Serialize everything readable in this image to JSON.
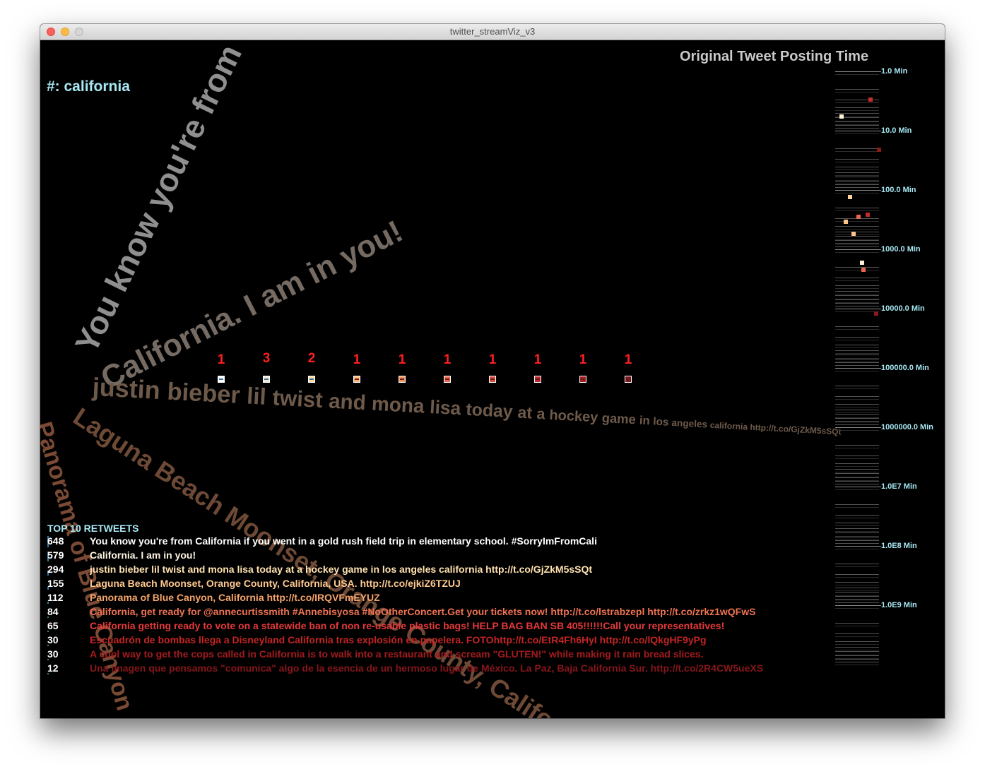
{
  "window": {
    "title": "twitter_streamViz_v3"
  },
  "hashtag": "#: california",
  "timeline": {
    "title": "Original Tweet Posting Time",
    "axis_labels": [
      "1.0 Min",
      "10.0 Min",
      "100.0 Min",
      "1000.0 Min",
      "10000.0 Min",
      "100000.0 Min",
      "1000000.0 Min",
      "1.0E7 Min",
      "1.0E8 Min",
      "1.0E9 Min"
    ],
    "points": [
      {
        "minutes": 5.8,
        "color": "#fff3d6"
      },
      {
        "minutes": 1700,
        "color": "#fff3d6"
      },
      {
        "minutes": 21,
        "color": "#8b1a1a"
      },
      {
        "minutes": 130,
        "color": "#ffd39b"
      },
      {
        "minutes": 280,
        "color": "#e8664f"
      },
      {
        "minutes": 340,
        "color": "#ffc38a"
      },
      {
        "minutes": 540,
        "color": "#ffc38a"
      },
      {
        "minutes": 2200,
        "color": "#e8664f"
      },
      {
        "minutes": 3,
        "color": "#c62a2a"
      },
      {
        "minutes": 260,
        "color": "#c62a2a"
      },
      {
        "minutes": 12000,
        "color": "#8b1a1a"
      }
    ]
  },
  "categories": [
    {
      "count": "1",
      "color": "#ffffff"
    },
    {
      "count": "3",
      "color": "#f4ecd0"
    },
    {
      "count": "2",
      "color": "#ffd9a0"
    },
    {
      "count": "1",
      "color": "#f9b877"
    },
    {
      "count": "1",
      "color": "#f4935c"
    },
    {
      "count": "1",
      "color": "#e8664f"
    },
    {
      "count": "1",
      "color": "#d84a3c"
    },
    {
      "count": "1",
      "color": "#c1262c"
    },
    {
      "count": "1",
      "color": "#a61d24"
    },
    {
      "count": "1",
      "color": "#7a1620"
    }
  ],
  "floating_tweets": [
    {
      "text": "You know you're from",
      "color": "#8f8f8f"
    },
    {
      "text": "California. I am in you!",
      "color": "#756b63"
    },
    {
      "text": "justin bieber lil twist and mona lisa today at a hockey game in los angeles california  http://t.co/GjZkM5sSQt",
      "color": "#6e5a4a"
    },
    {
      "text": "Laguna Beach Moonset, Orange County, California",
      "color": "#6e4a36"
    },
    {
      "text": "Panorama of Blue Canyon",
      "color": "#7a4a34"
    }
  ],
  "top_retweets": {
    "heading": "TOP 10 RETWEETS",
    "items": [
      {
        "count": "648",
        "text": "You know you're from California if you went in a gold rush field trip in elementary school. #SorryImFromCali",
        "color": "#ffffff"
      },
      {
        "count": "579",
        "text": "California. I am in you!",
        "color": "#fdf5e2"
      },
      {
        "count": "294",
        "text": "justin bieber lil twist and mona lisa today at a hockey game in los angeles california  http://t.co/GjZkM5sSQt",
        "color": "#ffe3b0"
      },
      {
        "count": "155",
        "text": "Laguna Beach Moonset, Orange County, California, USA. http://t.co/ejkiZ6TZUJ",
        "color": "#ffc98f"
      },
      {
        "count": "112",
        "text": "Panorama of Blue Canyon, California http://t.co/IRQVFmEYUZ",
        "color": "#f6a56a"
      },
      {
        "count": "84",
        "text": "California, get ready for @annecurtissmith #Annebisyosa #NoOtherConcert.Get your tickets now! http://t.co/lstrabzepl http://t.co/zrkz1wQFwS",
        "color": "#ef7252"
      },
      {
        "count": "65",
        "text": "California getting ready to vote on a statewide ban of non re-usable plastic bags! HELP BAG BAN SB 405!!!!!!Call your representatives!",
        "color": "#e6393a"
      },
      {
        "count": "30",
        "text": "Escuadrón de bombas llega a Disneyland California tras explosión en papelera. FOTOhttp://t.co/EtR4Fh6HyI http://t.co/lQkgHF9yPg",
        "color": "#c42424"
      },
      {
        "count": "30",
        "text": "A cool way to get the cops called in California is to walk into a restaurant and scream \"GLUTEN!\" while making it rain bread slices.",
        "color": "#a51a1e"
      },
      {
        "count": "12",
        "text": "Una imagen que pensamos \"comunica\" algo de la esencia de un hermoso lugar de México. La Paz, Baja California Sur. http://t.co/2R4CW5ueXS",
        "color": "#86161b"
      }
    ]
  }
}
